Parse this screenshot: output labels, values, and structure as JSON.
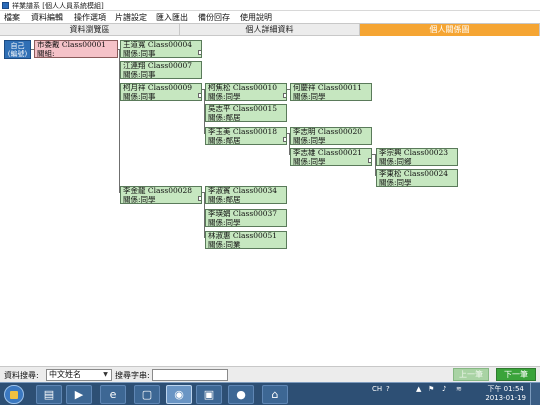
{
  "window": {
    "title": "祥業譜系 [個人人員系統模組]"
  },
  "menu": [
    "檔案",
    "資料編輯",
    "操作選項",
    "片譜設定",
    "匯入匯出",
    "備份回存",
    "使用說明"
  ],
  "tabs": [
    "資料瀏覽區",
    "個人詳細資料",
    "個人關係圖"
  ],
  "graph": {
    "self": {
      "line1": "自己",
      "line2": "(編號)"
    },
    "root": {
      "line1": "市委戴 Class00001",
      "line2": "關組:"
    },
    "nodes": [
      {
        "line1": "王道寬 Class00004",
        "line2": "關係:同事"
      },
      {
        "line1": "江連翔 Class00007",
        "line2": "關係:同事"
      },
      {
        "line1": "柯月祥 Class00009",
        "line2": "關係:同事"
      },
      {
        "line1": "柯焦松 Class00010",
        "line2": "關係:同學"
      },
      {
        "line1": "何慶祥 Class00011",
        "line2": "關係:同學"
      },
      {
        "line1": "吳志平 Class00015",
        "line2": "關係:鄰居"
      },
      {
        "line1": "李玉美 Class00018",
        "line2": "關係:鄰居"
      },
      {
        "line1": "李志明 Class00020",
        "line2": "關係:同學"
      },
      {
        "line1": "李志雄 Class00021",
        "line2": "關係:同學"
      },
      {
        "line1": "李宗興 Class00023",
        "line2": "關係:同鄉"
      },
      {
        "line1": "李東松 Class00024",
        "line2": "關係:同學"
      },
      {
        "line1": "李金龍 Class00028",
        "line2": "關係:同學"
      },
      {
        "line1": "李淑賓 Class00034",
        "line2": "關係:鄰居"
      },
      {
        "line1": "李瑛娟 Class00037",
        "line2": "關係:同學"
      },
      {
        "line1": "林淑惠 Class00051",
        "line2": "關係:同業"
      }
    ]
  },
  "bottom": {
    "source_label": "資料搜尋:",
    "source_value": "中文姓名",
    "search_label": "搜尋字串:",
    "search_value": "",
    "prev_label": "上一筆",
    "next_label": "下一筆"
  },
  "taskbar": {
    "time": "下午 01:54",
    "date": "2013-01-19",
    "lang": "CH"
  }
}
